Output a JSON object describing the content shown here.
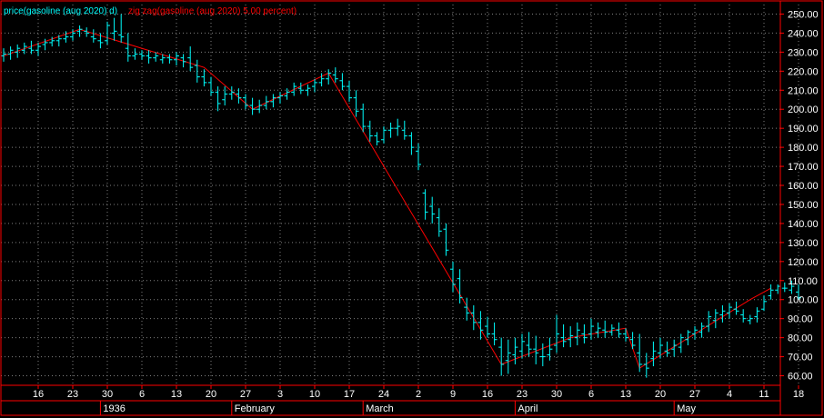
{
  "legend": {
    "price_label": "price(gasoline (aug 2020) d)",
    "zigzag_label": "zig zag(gasoline (aug 2020) 5.00 percent)"
  },
  "colors": {
    "background": "#000000",
    "frame": "#ff0000",
    "grid": "#808080",
    "price": "#00ffff",
    "zigzag": "#ff0000",
    "text": "#ffffff"
  },
  "chart_data": {
    "type": "line",
    "title": "",
    "xlabel": "",
    "ylabel": "",
    "ylim": [
      55,
      255
    ],
    "y_ticks": [
      60,
      70,
      80,
      90,
      100,
      110,
      120,
      130,
      140,
      150,
      160,
      170,
      180,
      190,
      200,
      210,
      220,
      230,
      240,
      250
    ],
    "x_tick_labels": [
      "16",
      "23",
      "30",
      "6",
      "13",
      "20",
      "27",
      "3",
      "10",
      "17",
      "24",
      "2",
      "9",
      "16",
      "23",
      "30",
      "6",
      "13",
      "20",
      "27",
      "4",
      "11",
      "18"
    ],
    "x_month_labels": [
      "1936",
      "February",
      "March",
      "April",
      "May"
    ],
    "grid": true,
    "series": [
      {
        "style": "ohlc",
        "values": [
          [
            228,
            232,
            225,
            229
          ],
          [
            229,
            233,
            226,
            231
          ],
          [
            230,
            234,
            227,
            232
          ],
          [
            231,
            235,
            229,
            233
          ],
          [
            232,
            236,
            229,
            231
          ],
          [
            231,
            235,
            228,
            233
          ],
          [
            234,
            237,
            231,
            235
          ],
          [
            235,
            238,
            233,
            236
          ],
          [
            236,
            239,
            233,
            237
          ],
          [
            237,
            241,
            235,
            238
          ],
          [
            238,
            242,
            236,
            240
          ],
          [
            241,
            244,
            238,
            242
          ],
          [
            241,
            243,
            238,
            240
          ],
          [
            238,
            242,
            235,
            237
          ],
          [
            236,
            240,
            232,
            235
          ],
          [
            236,
            246,
            234,
            244
          ],
          [
            240,
            248,
            236,
            241
          ],
          [
            239,
            250,
            235,
            238
          ],
          [
            232,
            240,
            225,
            228
          ],
          [
            228,
            232,
            226,
            229
          ],
          [
            229,
            231,
            226,
            228
          ],
          [
            228,
            231,
            224,
            227
          ],
          [
            227,
            230,
            225,
            228
          ],
          [
            226,
            229,
            224,
            227
          ],
          [
            227,
            229,
            224,
            226
          ],
          [
            226,
            230,
            223,
            228
          ],
          [
            227,
            229,
            222,
            225
          ],
          [
            227,
            233,
            220,
            222
          ],
          [
            223,
            226,
            214,
            217
          ],
          [
            217,
            221,
            212,
            214
          ],
          [
            214,
            217,
            207,
            209
          ],
          [
            209,
            212,
            199,
            203
          ],
          [
            205,
            212,
            202,
            208
          ],
          [
            208,
            212,
            205,
            209
          ],
          [
            208,
            211,
            203,
            206
          ],
          [
            206,
            208,
            200,
            202
          ],
          [
            202,
            206,
            197,
            200
          ],
          [
            200,
            205,
            198,
            202
          ],
          [
            202,
            207,
            200,
            204
          ],
          [
            204,
            208,
            201,
            206
          ],
          [
            206,
            209,
            203,
            207
          ],
          [
            207,
            211,
            205,
            209
          ],
          [
            209,
            214,
            207,
            212
          ],
          [
            211,
            214,
            208,
            210
          ],
          [
            210,
            213,
            207,
            211
          ],
          [
            212,
            216,
            209,
            214
          ],
          [
            214,
            219,
            212,
            216
          ],
          [
            216,
            221,
            213,
            219
          ],
          [
            218,
            222,
            214,
            216
          ],
          [
            215,
            219,
            210,
            212
          ],
          [
            212,
            215,
            204,
            206
          ],
          [
            206,
            210,
            196,
            199
          ],
          [
            200,
            203,
            188,
            191
          ],
          [
            191,
            194,
            183,
            186
          ],
          [
            186,
            188,
            181,
            183
          ],
          [
            184,
            191,
            182,
            189
          ],
          [
            189,
            193,
            185,
            190
          ],
          [
            190,
            195,
            186,
            191
          ],
          [
            189,
            194,
            184,
            186
          ],
          [
            186,
            188,
            176,
            180
          ],
          [
            178,
            182,
            168,
            171
          ],
          [
            156,
            158,
            142,
            146
          ],
          [
            149,
            154,
            140,
            145
          ],
          [
            143,
            148,
            133,
            136
          ],
          [
            137,
            140,
            123,
            126
          ],
          [
            116,
            120,
            104,
            108
          ],
          [
            111,
            116,
            98,
            101
          ],
          [
            96,
            101,
            89,
            93
          ],
          [
            93,
            97,
            84,
            88
          ],
          [
            88,
            94,
            79,
            84
          ],
          [
            86,
            91,
            80,
            82
          ],
          [
            82,
            88,
            76,
            79
          ],
          [
            75,
            80,
            60,
            66
          ],
          [
            68,
            79,
            61,
            72
          ],
          [
            71,
            80,
            66,
            75
          ],
          [
            73,
            82,
            69,
            78
          ],
          [
            76,
            83,
            70,
            74
          ],
          [
            74,
            81,
            66,
            72
          ],
          [
            70,
            77,
            65,
            70
          ],
          [
            71,
            80,
            68,
            74
          ],
          [
            76,
            92,
            72,
            82
          ],
          [
            80,
            87,
            75,
            78
          ],
          [
            79,
            86,
            75,
            81
          ],
          [
            80,
            88,
            76,
            84
          ],
          [
            82,
            87,
            77,
            80
          ],
          [
            82,
            90,
            79,
            86
          ],
          [
            83,
            88,
            80,
            85
          ],
          [
            84,
            89,
            80,
            83
          ],
          [
            83,
            87,
            81,
            85
          ],
          [
            84,
            88,
            80,
            82
          ],
          [
            82,
            85,
            78,
            80
          ],
          [
            79,
            83,
            74,
            76
          ],
          [
            72,
            82,
            62,
            66
          ],
          [
            66,
            72,
            59,
            64
          ],
          [
            69,
            78,
            65,
            73
          ],
          [
            72,
            80,
            69,
            76
          ],
          [
            73,
            78,
            70,
            72
          ],
          [
            74,
            79,
            70,
            76
          ],
          [
            75,
            82,
            72,
            80
          ],
          [
            79,
            84,
            76,
            83
          ],
          [
            82,
            86,
            79,
            84
          ],
          [
            83,
            88,
            80,
            86
          ],
          [
            86,
            94,
            83,
            91
          ],
          [
            89,
            95,
            85,
            93
          ],
          [
            92,
            97,
            88,
            94
          ],
          [
            93,
            98,
            90,
            96
          ],
          [
            95,
            99,
            92,
            94
          ],
          [
            92,
            95,
            88,
            90
          ],
          [
            89,
            92,
            87,
            90
          ],
          [
            91,
            96,
            88,
            94
          ],
          [
            95,
            102,
            94,
            99
          ],
          [
            102,
            108,
            100,
            105
          ],
          [
            105,
            108,
            103,
            107
          ],
          [
            106,
            109,
            104,
            106
          ],
          [
            105,
            110,
            103,
            107
          ],
          [
            104,
            108,
            100,
            101
          ]
        ]
      },
      {
        "style": "line",
        "values": [
          [
            0,
            228
          ],
          [
            11,
            242
          ],
          [
            29,
            222
          ],
          [
            36,
            200
          ],
          [
            47,
            219
          ],
          [
            72,
            66
          ],
          [
            82,
            80
          ],
          [
            90,
            85
          ],
          [
            92,
            64
          ],
          [
            108,
            100
          ],
          [
            111,
            106
          ]
        ]
      }
    ]
  }
}
